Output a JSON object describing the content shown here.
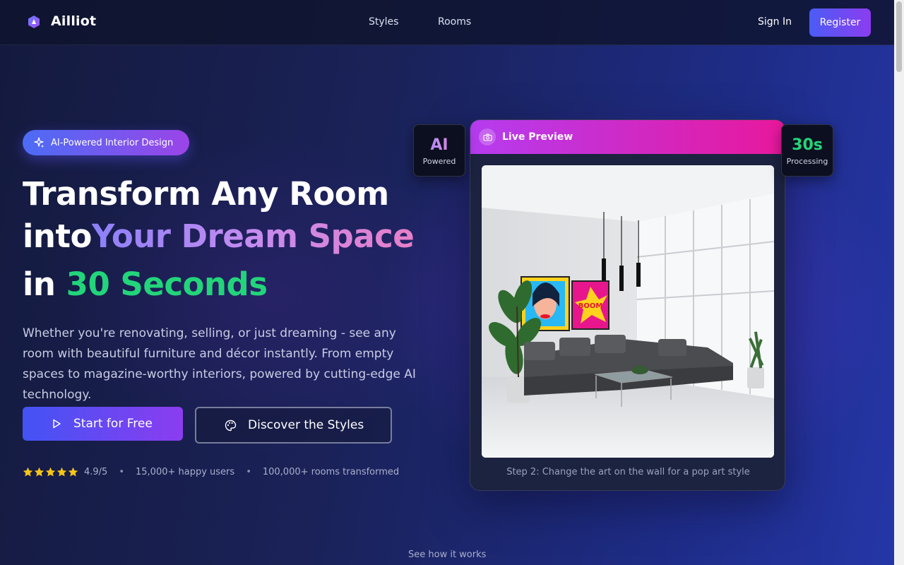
{
  "nav": {
    "brand": "Ailliot",
    "links": [
      "Styles",
      "Rooms"
    ],
    "sign_in": "Sign In",
    "register": "Register"
  },
  "hero": {
    "badge": "AI-Powered Interior Design",
    "headline": {
      "line1": "Transform Any Room",
      "line2_prefix": "into",
      "line2_highlight": "Your Dream Space",
      "line3_prefix": "in",
      "line3_highlight": "30 Seconds"
    },
    "description": "Whether you're renovating, selling, or just dreaming - see any room with beautiful furniture and décor instantly. From empty spaces to magazine-worthy interiors, powered by cutting-edge AI technology.",
    "cta_primary": "Start for Free",
    "cta_secondary": "Discover the Styles",
    "stats": {
      "rating": "4.9/5",
      "stars": 5,
      "users": "15,000+ happy users",
      "rooms": "100,000+ rooms transformed"
    }
  },
  "preview": {
    "title": "Live Preview",
    "caption": "Step 2: Change the art on the wall for a pop art style",
    "badge_left": {
      "big": "AI",
      "small": "Powered"
    },
    "badge_right": {
      "big": "30s",
      "small": "Processing"
    }
  },
  "footer_hint": "See how it works",
  "colors": {
    "accent_gradient_start": "#4353f4",
    "accent_gradient_end": "#8b3df0",
    "green": "#22d57a",
    "preview_header_start": "#b53cf0",
    "preview_header_end": "#e8189c",
    "star": "#f5c518"
  },
  "icons": [
    "logo-icon",
    "sparkles-icon",
    "play-icon",
    "palette-icon",
    "star-icon",
    "camera-icon"
  ]
}
